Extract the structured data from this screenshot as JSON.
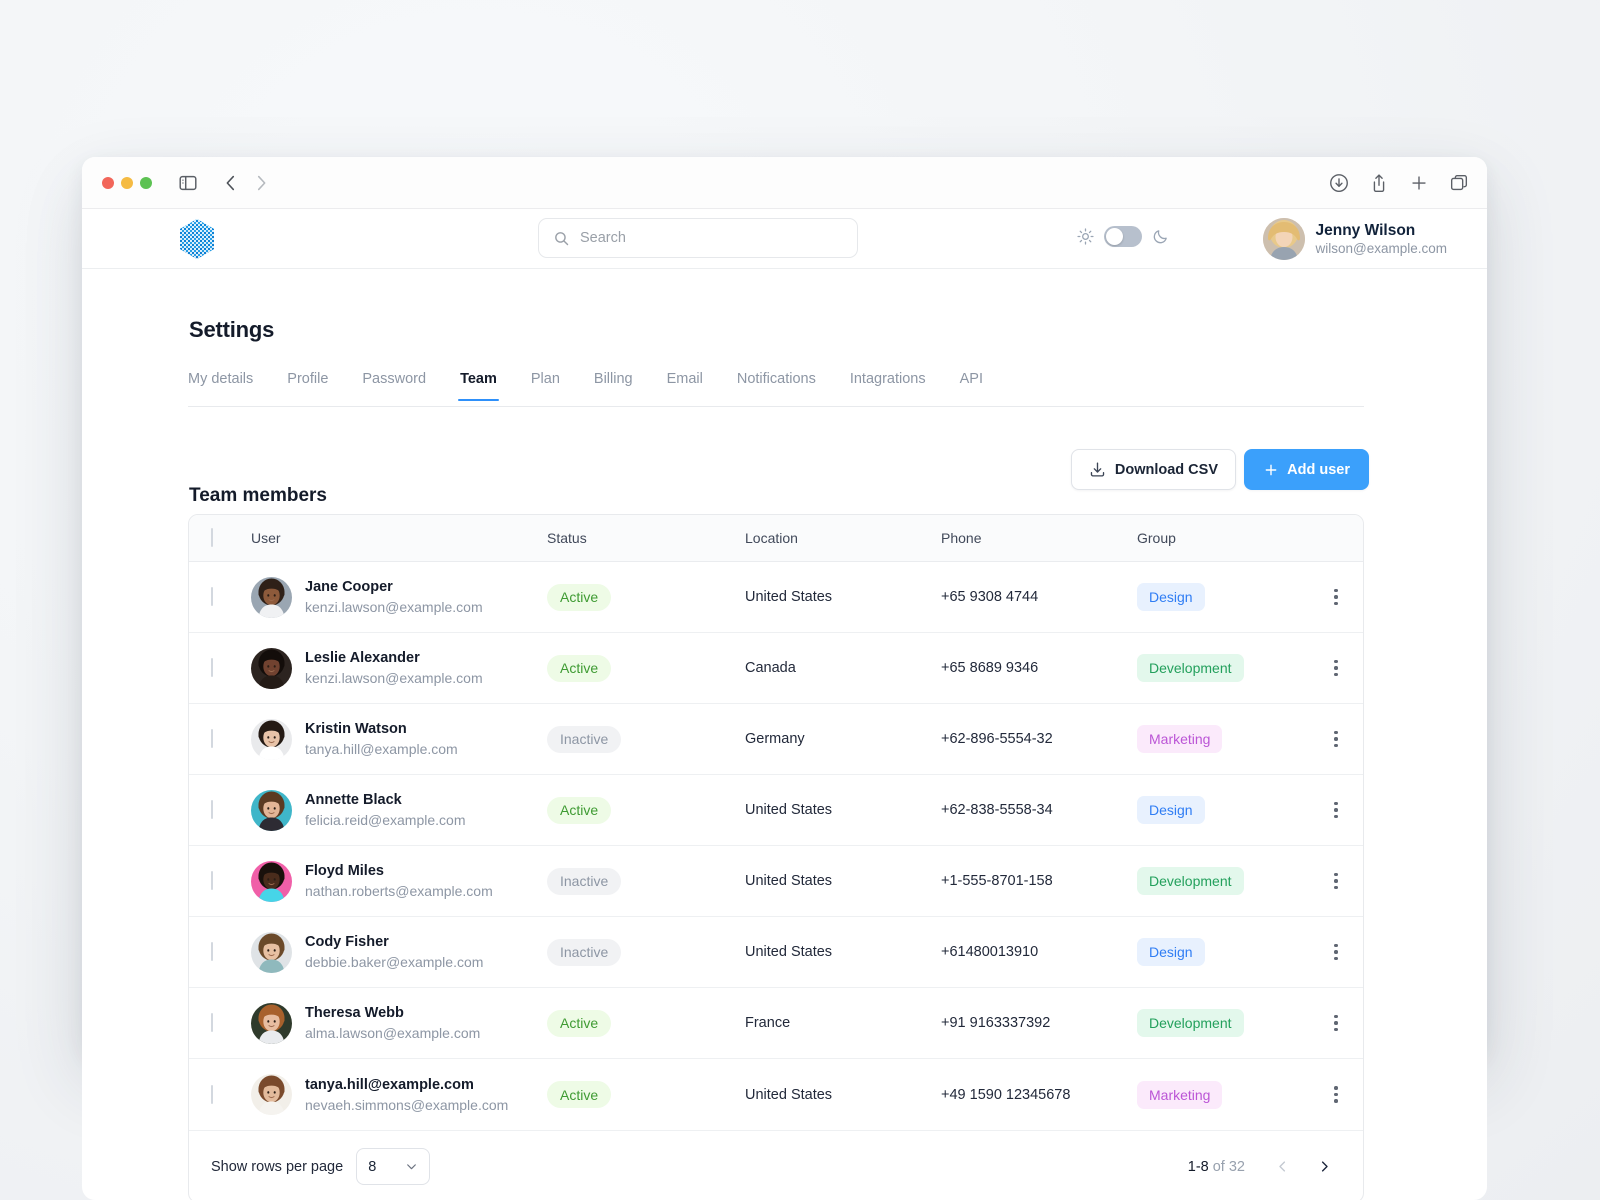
{
  "browser": {
    "toolbar_icons": [
      "sidebar-icon",
      "back-icon",
      "forward-icon",
      "download-icon",
      "share-icon",
      "plus-icon",
      "tabs-icon"
    ]
  },
  "app_header": {
    "logo_name": "brand-logo",
    "search": {
      "value": "",
      "placeholder": "Search"
    },
    "theme": {
      "light_icon": "sun-icon",
      "dark_icon": "moon-icon",
      "state": "light"
    },
    "user": {
      "name": "Jenny Wilson",
      "email": "wilson@example.com"
    }
  },
  "page": {
    "title": "Settings",
    "tabs": [
      {
        "label": "My details",
        "active": false
      },
      {
        "label": "Profile",
        "active": false
      },
      {
        "label": "Password",
        "active": false
      },
      {
        "label": "Team",
        "active": true
      },
      {
        "label": "Plan",
        "active": false
      },
      {
        "label": "Billing",
        "active": false
      },
      {
        "label": "Email",
        "active": false
      },
      {
        "label": "Notifications",
        "active": false
      },
      {
        "label": "Intagrations",
        "active": false
      },
      {
        "label": "API",
        "active": false
      }
    ],
    "section_title": "Team members",
    "download_label": "Download CSV",
    "add_user_label": "Add user"
  },
  "table": {
    "columns": [
      "User",
      "Status",
      "Location",
      "Phone",
      "Group"
    ],
    "rows": [
      {
        "name": "Jane Cooper",
        "email": "kenzi.lawson@example.com",
        "status": "Active",
        "location": "United States",
        "phone": "+65 9308 4744",
        "group": "Design"
      },
      {
        "name": "Leslie Alexander",
        "email": "kenzi.lawson@example.com",
        "status": "Active",
        "location": "Canada",
        "phone": "+65 8689 9346",
        "group": "Development"
      },
      {
        "name": "Kristin Watson",
        "email": "tanya.hill@example.com",
        "status": "Inactive",
        "location": "Germany",
        "phone": "+62-896-5554-32",
        "group": "Marketing"
      },
      {
        "name": "Annette Black",
        "email": "felicia.reid@example.com",
        "status": "Active",
        "location": "United States",
        "phone": "+62-838-5558-34",
        "group": "Design"
      },
      {
        "name": "Floyd Miles",
        "email": "nathan.roberts@example.com",
        "status": "Inactive",
        "location": "United States",
        "phone": "+1-555-8701-158",
        "group": "Development"
      },
      {
        "name": "Cody Fisher",
        "email": "debbie.baker@example.com",
        "status": "Inactive",
        "location": "United States",
        "phone": "+61480013910",
        "group": "Design"
      },
      {
        "name": "Theresa Webb",
        "email": "alma.lawson@example.com",
        "status": "Active",
        "location": "France",
        "phone": "+91 9163337392",
        "group": "Development"
      },
      {
        "name": "tanya.hill@example.com",
        "email": "nevaeh.simmons@example.com",
        "status": "Active",
        "location": "United States",
        "phone": "+49 1590 12345678",
        "group": "Marketing"
      }
    ]
  },
  "pagination": {
    "rows_label": "Show rows per page",
    "rows_value": "8",
    "range_current": "1-8",
    "range_of": " of 32",
    "prev_icon": "chevron-left-icon",
    "next_icon": "chevron-right-icon"
  },
  "colors": {
    "accent": "#3ba0fb",
    "tab_underline": "#2e90fa",
    "status_active_bg": "#eefbe6",
    "status_active_fg": "#3f9b33",
    "status_inactive_bg": "#f1f2f4",
    "status_inactive_fg": "#8d96a4",
    "group_design_bg": "#e8f1fe",
    "group_design_fg": "#2f7df4",
    "group_development_bg": "#e3f8ec",
    "group_development_fg": "#23a05c",
    "group_marketing_bg": "#fbeafb",
    "group_marketing_fg": "#bb55d6"
  }
}
